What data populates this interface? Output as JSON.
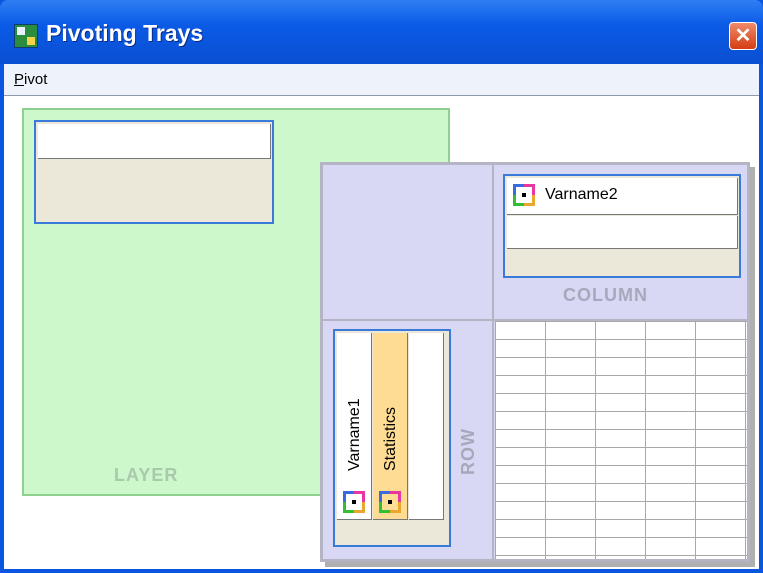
{
  "window": {
    "title": "Pivoting Trays",
    "close_symbol": "✕"
  },
  "menu": {
    "items": [
      {
        "accel": "P",
        "rest": "ivot"
      }
    ]
  },
  "trays": {
    "layer": {
      "label": "LAYER"
    },
    "column": {
      "label": "COLUMN",
      "fields": [
        "Varname2"
      ]
    },
    "row": {
      "label": "ROW",
      "fields": [
        "Varname1",
        "Statistics"
      ]
    }
  },
  "icons": {
    "app": "pivot-table-app-icon",
    "field": "pivot-field-icon"
  },
  "colors": {
    "layer_tray": "#ccf8cc",
    "pivot_panel": "#d8d8f4",
    "statistics_highlight": "#ffdc94",
    "title_bar": "#0a5ae6"
  }
}
